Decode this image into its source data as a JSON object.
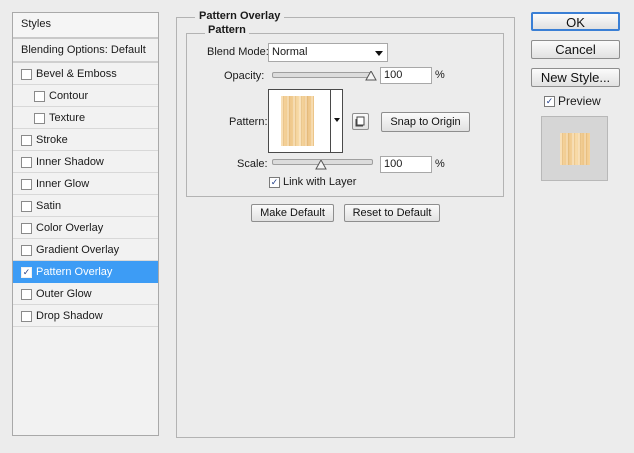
{
  "styles_panel": {
    "header": "Styles",
    "blending_options": "Blending Options: Default",
    "items": [
      {
        "label": "Bevel & Emboss",
        "checked": false
      },
      {
        "label": "Contour",
        "checked": false
      },
      {
        "label": "Texture",
        "checked": false
      },
      {
        "label": "Stroke",
        "checked": false
      },
      {
        "label": "Inner Shadow",
        "checked": false
      },
      {
        "label": "Inner Glow",
        "checked": false
      },
      {
        "label": "Satin",
        "checked": false
      },
      {
        "label": "Color Overlay",
        "checked": false
      },
      {
        "label": "Gradient Overlay",
        "checked": false
      },
      {
        "label": "Pattern Overlay",
        "checked": true,
        "selected": true
      },
      {
        "label": "Outer Glow",
        "checked": false
      },
      {
        "label": "Drop Shadow",
        "checked": false
      }
    ],
    "check_mark": "✓"
  },
  "pattern_overlay": {
    "title": "Pattern Overlay",
    "group_title": "Pattern",
    "blend_mode_label": "Blend Mode:",
    "blend_mode_value": "Normal",
    "opacity_label": "Opacity:",
    "opacity_value": "100",
    "opacity_unit": "%",
    "opacity_level": 1.0,
    "pattern_label": "Pattern:",
    "snap_button": "Snap to Origin",
    "scale_label": "Scale:",
    "scale_value": "100",
    "scale_unit": "%",
    "link_label": "Link with Layer",
    "link_checked": true,
    "make_default": "Make Default",
    "reset_default": "Reset to Default",
    "pattern_swatch_color": "#f3d29b"
  },
  "dialog_buttons": {
    "ok": "OK",
    "cancel": "Cancel",
    "new_style": "New Style...",
    "preview_label": "Preview",
    "preview_checked": true
  },
  "colors": {
    "selection": "#3d9cf5",
    "dialog_bg": "#ececec"
  }
}
